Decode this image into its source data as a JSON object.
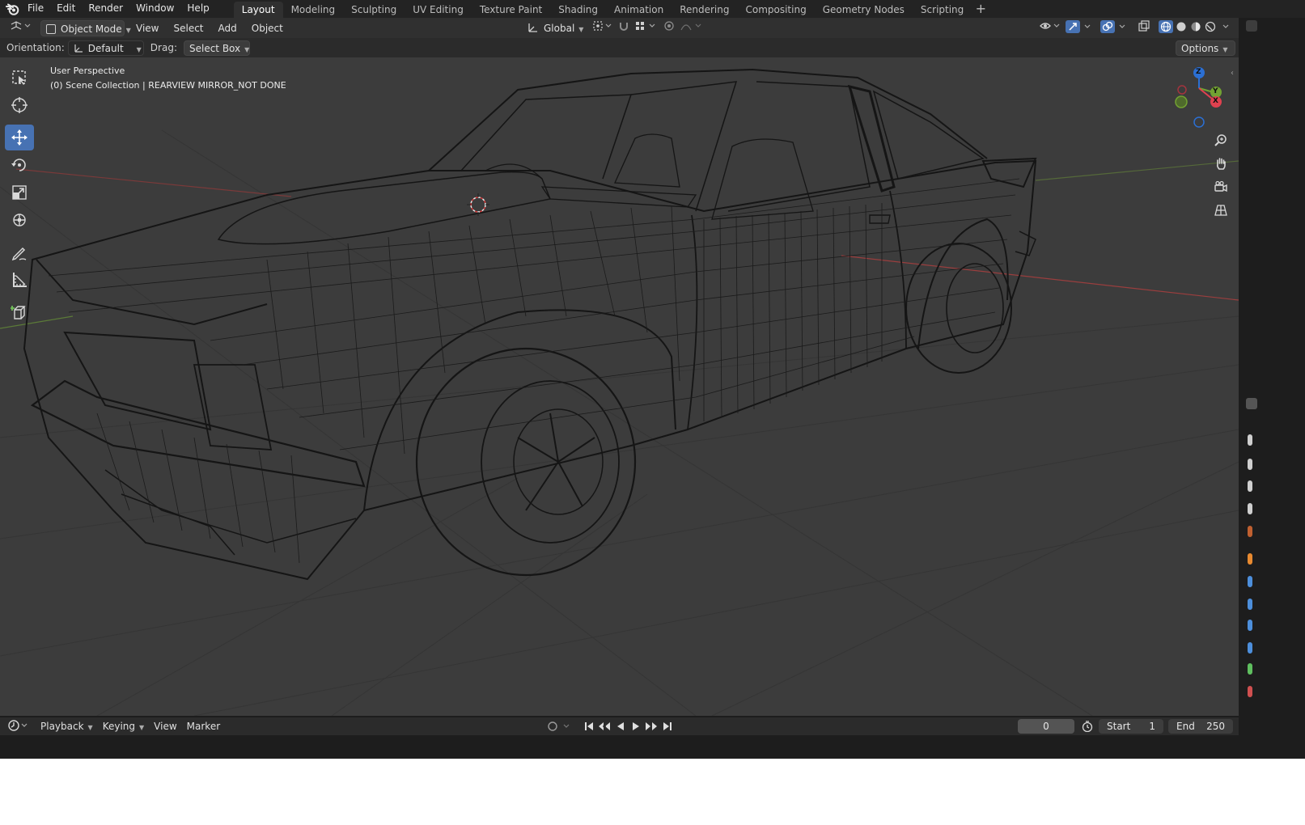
{
  "menubar": {
    "items": [
      "File",
      "Edit",
      "Render",
      "Window",
      "Help"
    ],
    "workspaces": [
      "Layout",
      "Modeling",
      "Sculpting",
      "UV Editing",
      "Texture Paint",
      "Shading",
      "Animation",
      "Rendering",
      "Compositing",
      "Geometry Nodes",
      "Scripting"
    ],
    "active_workspace": "Layout",
    "add_symbol": "+"
  },
  "header": {
    "mode": "Object Mode",
    "menus": [
      "View",
      "Select",
      "Add",
      "Object"
    ],
    "transform_orientation": "Global",
    "options": "Options"
  },
  "toolsettings": {
    "orientation_label": "Orientation:",
    "orientation_value": "Default",
    "drag_label": "Drag:",
    "drag_value": "Select Box"
  },
  "viewport": {
    "perspective": "User Perspective",
    "collection": "(0) Scene Collection | REARVIEW MIRROR_NOT DONE",
    "gizmo_axes": {
      "z": "Z",
      "y": "Y",
      "x": "X"
    },
    "axis_colors": {
      "x": "#e0414f",
      "y": "#72a232",
      "z": "#2b6fd3"
    },
    "background": "#3c3c3c",
    "wire_color": "#141414"
  },
  "toolbar": {
    "tools": [
      "select-box-icon",
      "cursor-icon",
      "move-icon",
      "rotate-icon",
      "scale-icon",
      "transform-icon",
      "annotate-icon",
      "measure-icon",
      "add-cube-icon"
    ],
    "active_tool": "move-icon"
  },
  "timeline": {
    "menus": [
      "Playback",
      "Keying",
      "View",
      "Marker"
    ],
    "current_frame": "0",
    "start_label": "Start",
    "start_value": "1",
    "end_label": "End",
    "end_value": "250"
  },
  "colors": {
    "accent": "#4772b3",
    "panel": "#303030",
    "dark": "#1d1d1d"
  }
}
